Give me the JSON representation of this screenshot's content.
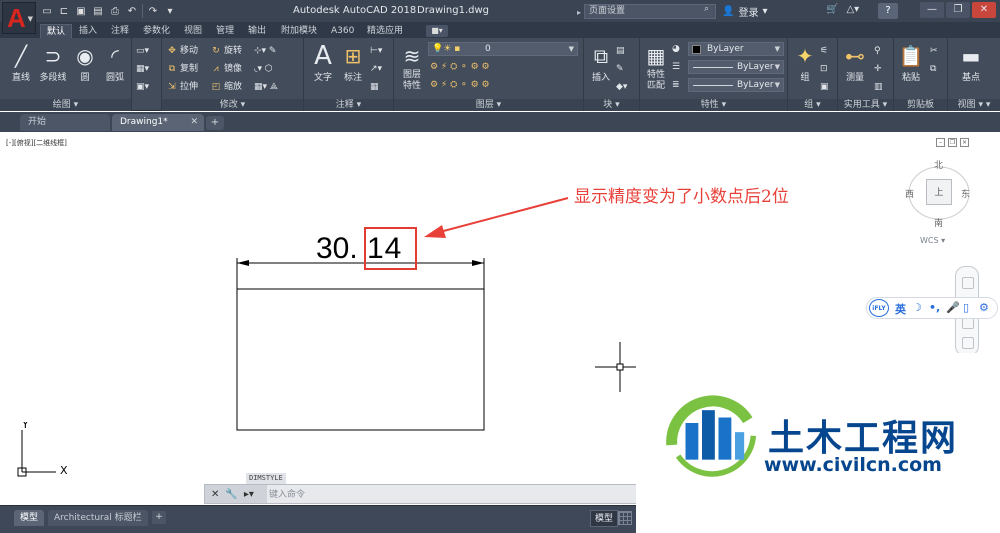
{
  "titlebar": {
    "app_letter": "A",
    "app_name": "Autodesk AutoCAD 2018",
    "file_name": "Drawing1.dwg",
    "search_placeholder": "页面设置",
    "login": "登录",
    "help": "?"
  },
  "ribbon_tabs": [
    "默认",
    "插入",
    "注释",
    "参数化",
    "视图",
    "管理",
    "输出",
    "附加模块",
    "A360",
    "精选应用"
  ],
  "ribbon_tab_extra": "■▾",
  "panels": {
    "draw": {
      "title": "绘图",
      "line": "直线",
      "polyline": "多段线",
      "circle": "圆",
      "arc": "圆弧"
    },
    "modify": {
      "title": "修改",
      "move": "移动",
      "rotate": "旋转",
      "copy": "复制",
      "mirror": "镜像",
      "stretch": "拉伸",
      "scale": "缩放"
    },
    "annotation": {
      "title": "注释",
      "text": "文字",
      "dimension": "标注"
    },
    "layers": {
      "title": "图层",
      "layer_props": "图层特性",
      "current_layer": "0"
    },
    "block": {
      "title": "块",
      "insert": "插入"
    },
    "properties": {
      "title": "特性",
      "match": "特性匹配",
      "color": "ByLayer",
      "linetype": "ByLayer",
      "lineweight": "ByLayer"
    },
    "groups": {
      "title": "组",
      "group": "组"
    },
    "utilities": {
      "title": "实用工具",
      "measure": "测量"
    },
    "clipboard": {
      "title": "剪贴板",
      "paste": "粘贴"
    },
    "view": {
      "title": "视图",
      "base": "基点"
    }
  },
  "file_tabs": {
    "start": "开始",
    "drawing": "Drawing1*",
    "plus": "+"
  },
  "viewport_label": "[-][俯视][二维线框]",
  "viewcube": {
    "north": "北",
    "south": "南",
    "east": "东",
    "west": "西",
    "top": "上",
    "wcs": "WCS ▾"
  },
  "ime": {
    "logo": "iFLY",
    "lang": "英"
  },
  "dimension": {
    "integer_part": "30.",
    "decimal_part": "14"
  },
  "annotation_text": "显示精度变为了小数点后2位",
  "ucs": {
    "x_label": "X",
    "y_label": "Y"
  },
  "command": {
    "history": "DIMSTYLE",
    "placeholder": "键入命令"
  },
  "status": {
    "model_tab": "模型",
    "layout_tab": "Architectural 标题栏",
    "plus": "+",
    "model_space": "模型"
  },
  "watermark": {
    "cn": "土木工程网",
    "url": "www.civilcn.com"
  },
  "colors": {
    "highlight": "#e23b32",
    "annotation": "#e8413a",
    "watermark_blue": "#06468f",
    "app_red": "#d7261e"
  }
}
